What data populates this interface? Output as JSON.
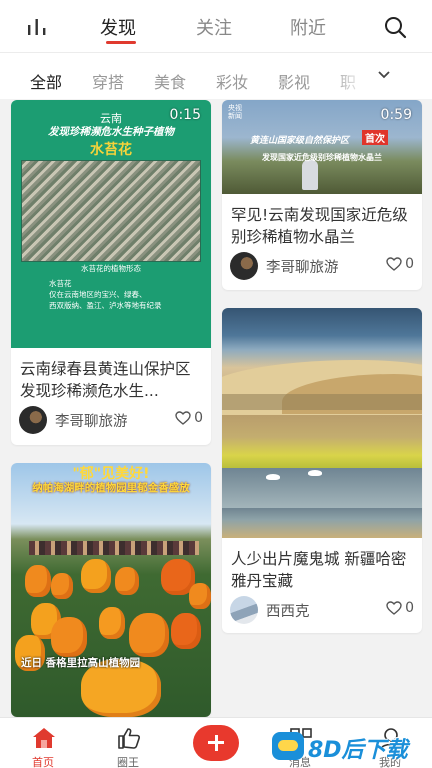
{
  "top_nav": {
    "tabs": [
      {
        "label": "发现",
        "active": true
      },
      {
        "label": "关注",
        "active": false
      },
      {
        "label": "附近",
        "active": false
      }
    ],
    "chart_icon": "bar-chart-icon",
    "search_icon": "search-icon"
  },
  "categories": {
    "items": [
      "全部",
      "穿搭",
      "美食",
      "彩妆",
      "影视",
      "职"
    ],
    "active": "全部",
    "more_icon": "chevron-down-icon"
  },
  "feed": [
    {
      "thumb": {
        "location": "云南",
        "caption_line1": "发现珍稀濒危水生种子植物",
        "caption_line2": "水苔花",
        "photo_caption": "水苔花的植物形态",
        "info_lines": [
          "水苔花",
          "仅在云南地区的宝兴、绿春、",
          "西双版纳、盈江、泸水等地有纪录"
        ]
      },
      "duration": "0:15",
      "title": "云南绿春县黄连山保护区发现珍稀濒危水生...",
      "author": "李哥聊旅游",
      "likes": "0"
    },
    {
      "thumb": {
        "logo_lines": [
          "央视",
          "新闻"
        ],
        "caption_line1": "黄连山国家级自然保护区",
        "badge": "首次",
        "caption_line2": "发现国家近危级别珍稀植物水晶兰"
      },
      "duration": "0:59",
      "title": "罕见!云南发现国家近危级别珍稀植物水晶兰",
      "author": "李哥聊旅游",
      "likes": "0"
    },
    {
      "thumb": {
        "headline1": "\"郁\"见美好!",
        "headline2": "纳帕海湖畔的植物园里郁金香盛放",
        "bottom_caption": "近日 香格里拉高山植物园"
      },
      "duration": "",
      "title": "",
      "author": "",
      "likes": ""
    },
    {
      "thumb": {},
      "duration": "",
      "title": "人少出片魔鬼城 新疆哈密雅丹宝藏",
      "author": "西西克",
      "likes": "0"
    }
  ],
  "tabbar": {
    "items": [
      {
        "label": "首页",
        "icon": "home-icon",
        "active": true
      },
      {
        "label": "圈王",
        "icon": "thumbs-up-icon",
        "active": false
      },
      {
        "label": "",
        "icon": "plus-icon",
        "active": false
      },
      {
        "label": "消息",
        "icon": "message-icon",
        "active": false
      },
      {
        "label": "我的",
        "icon": "profile-icon",
        "active": false
      }
    ]
  },
  "watermark": {
    "brand": "8D后下载"
  },
  "colors": {
    "accent": "#e03a2f",
    "brand_green": "#1c9d72",
    "plus_button": "#e8392d"
  }
}
